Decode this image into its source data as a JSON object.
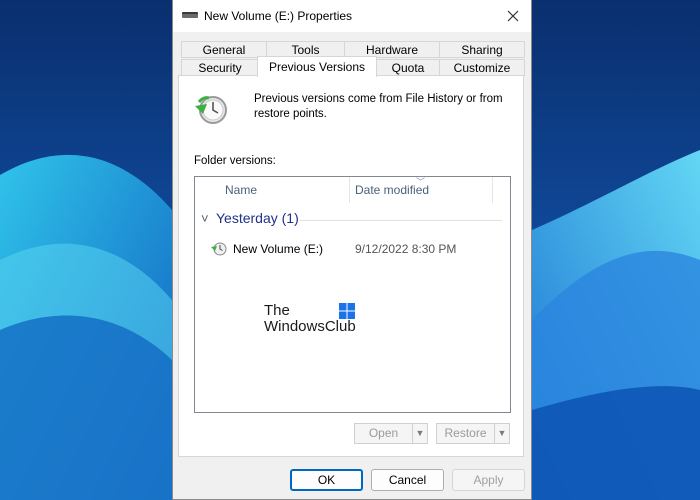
{
  "window": {
    "title": "New Volume (E:) Properties",
    "close_icon": "close-icon"
  },
  "tabs": {
    "row1": [
      "General",
      "Tools",
      "Hardware",
      "Sharing"
    ],
    "row2": [
      "Security",
      "Previous Versions",
      "Quota",
      "Customize"
    ],
    "active": "Previous Versions"
  },
  "previous_versions": {
    "description": "Previous versions come from File History or from restore points.",
    "folder_versions_label": "Folder versions:",
    "columns": [
      "Name",
      "Date modified"
    ],
    "group": "Yesterday (1)",
    "rows": [
      {
        "name": "New Volume (E:)",
        "date_modified": "9/12/2022 8:30 PM"
      }
    ],
    "open_label": "Open",
    "restore_label": "Restore"
  },
  "watermark": {
    "line1": "The",
    "line2": "WindowsClub"
  },
  "buttons": {
    "ok": "OK",
    "cancel": "Cancel",
    "apply": "Apply"
  },
  "colors": {
    "accent": "#0067c0",
    "group_text": "#1e3287",
    "desktop": "#0b3d8c"
  }
}
